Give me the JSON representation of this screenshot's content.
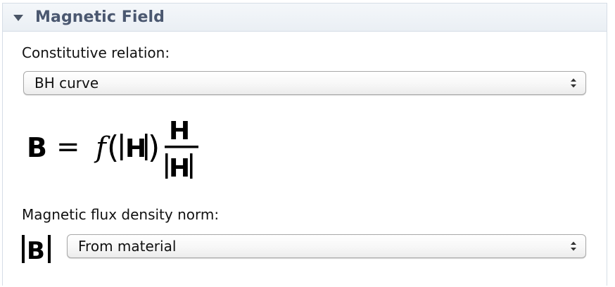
{
  "section": {
    "title": "Magnetic Field",
    "toggle_icon": "triangle-down-icon"
  },
  "constitutive": {
    "label": "Constitutive relation:",
    "selected": "BH curve",
    "icon": "select-spinner-icon"
  },
  "equation": {
    "lhs": "B",
    "equals": "=",
    "function": "f",
    "open_paren": "(",
    "close_paren": ")",
    "arg": "H",
    "numerator": "H",
    "denominator": "H"
  },
  "flux_density": {
    "label": "Magnetic flux density norm:",
    "symbol": "B",
    "selected": "From material",
    "icon": "select-spinner-icon"
  }
}
